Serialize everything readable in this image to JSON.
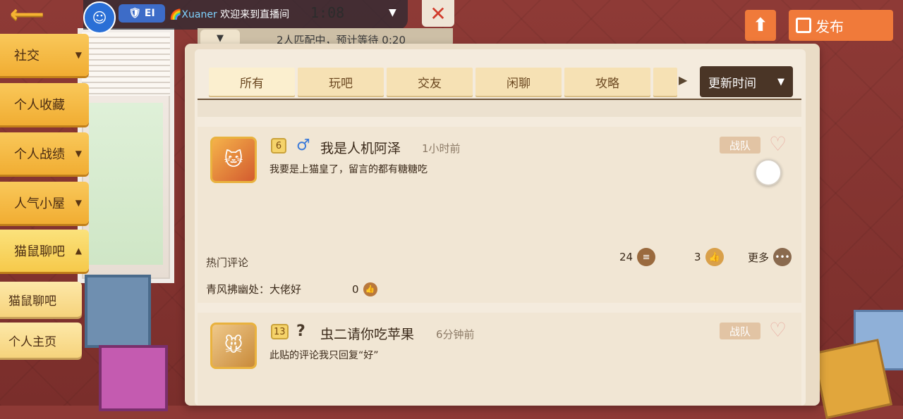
{
  "top": {
    "back_label": "⟵",
    "live": {
      "nickname": "🌈Xuaner",
      "welcome": "欢迎来到直播间",
      "timer": "1:08",
      "rank": "🛡 EI"
    },
    "close_label": "✕",
    "match_status": "2人匹配中，预计等待 0:20",
    "match_toggle": "▼",
    "post_label": "发布"
  },
  "nav": {
    "items": [
      {
        "label": "社交",
        "caret": "▼"
      },
      {
        "label": "个人收藏",
        "caret": ""
      },
      {
        "label": "个人战绩",
        "caret": "▼"
      },
      {
        "label": "人气小屋",
        "caret": "▼"
      },
      {
        "label": "猫鼠聊吧",
        "caret": "▲"
      }
    ],
    "sub_items": [
      {
        "label": "猫鼠聊吧"
      },
      {
        "label": "个人主页"
      }
    ]
  },
  "tabs": [
    "所有",
    "玩吧",
    "交友",
    "闲聊",
    "攻略"
  ],
  "sort": {
    "label": "更新时间",
    "caret": "▼"
  },
  "posts": [
    {
      "level": "6",
      "gender_icon": "♂",
      "username": "我是人机阿泽",
      "time": "1小时前",
      "content": "我要是上猫皇了，留言的都有糖糖吃",
      "team_label": "战队",
      "hot_label": "热门评论",
      "comments": "24",
      "likes": "3",
      "more_label": "更多",
      "top_comment": "青风拂幽处：大佬好",
      "top_comment_likes": "0"
    },
    {
      "level": "13",
      "gender_icon": "?",
      "username": "虫二请你吃苹果",
      "time": "6分钟前",
      "content": "此贴的评论我只回复“好”",
      "team_label": "战队"
    }
  ],
  "icons": {
    "heart": "♡",
    "comment": "≡",
    "like": "👍",
    "more": "•••",
    "upload": "⬆"
  }
}
